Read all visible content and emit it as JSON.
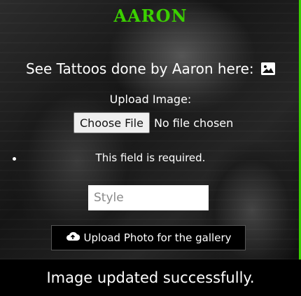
{
  "header": {
    "title": "AARON"
  },
  "gallery": {
    "subtitle": "See Tattoos done by Aaron here:",
    "image_icon": "image-icon"
  },
  "form": {
    "upload_label": "Upload Image:",
    "choose_file_label": "Choose File",
    "file_status": "No file chosen",
    "validation_message": "This field is required.",
    "style_placeholder": "Style",
    "style_value": "",
    "submit_label": "Upload Photo for the gallery",
    "submit_icon": "cloud-upload-icon"
  },
  "status": {
    "message": "Image updated successfully."
  },
  "colors": {
    "accent": "#3bd000",
    "footer_bg": "#000000"
  }
}
